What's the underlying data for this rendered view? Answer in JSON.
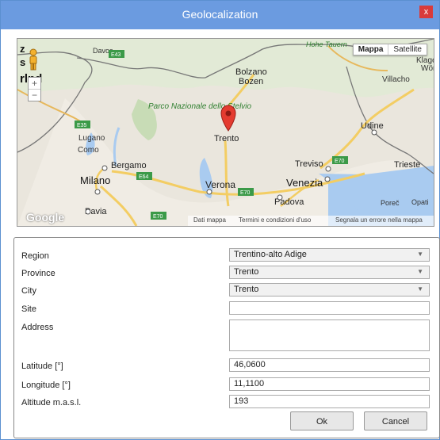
{
  "window": {
    "title": "Geolocalization",
    "close_symbol": "x"
  },
  "map": {
    "type_buttons": [
      "Mappa",
      "Satellite"
    ],
    "zoom": [
      "+",
      "−"
    ],
    "places": [
      {
        "name": "Davos"
      },
      {
        "name": "Bolzano"
      },
      {
        "name": "Bozen"
      },
      {
        "name": "Parco Nazionale dello Stelvio"
      },
      {
        "name": "Trento"
      },
      {
        "name": "Lugano"
      },
      {
        "name": "Como"
      },
      {
        "name": "Bergamo"
      },
      {
        "name": "Milano"
      },
      {
        "name": "Pavia"
      },
      {
        "name": "Verona"
      },
      {
        "name": "Padova"
      },
      {
        "name": "Venezia"
      },
      {
        "name": "Treviso"
      },
      {
        "name": "Udine"
      },
      {
        "name": "Trieste"
      },
      {
        "name": "Villacho"
      },
      {
        "name": "Hohe Tauern"
      },
      {
        "name": "Poreč"
      },
      {
        "name": "Opati"
      },
      {
        "name": "Klage"
      },
      {
        "name": "Wör"
      }
    ],
    "roads": [
      "E43",
      "E35",
      "E64",
      "E70",
      "E70",
      "E70"
    ],
    "partial_text": [
      "rlnd",
      "z",
      "s"
    ],
    "logo": "Google",
    "footer": [
      "Dati mappa",
      "Termini e condizioni d'uso",
      "Segnala un errore nella mappa"
    ]
  },
  "form": {
    "region_label": "Region",
    "region_value": "Trentino-alto Adige",
    "province_label": "Province",
    "province_value": "Trento",
    "city_label": "City",
    "city_value": "Trento",
    "site_label": "Site",
    "site_value": "",
    "address_label": "Address",
    "address_value": "",
    "latitude_label": "Latitude [°]",
    "latitude_value": "46,0600",
    "longitude_label": "Longitude [°]",
    "longitude_value": "11,1100",
    "altitude_label": "Altitude m.a.s.l.",
    "altitude_value": "193",
    "ok_label": "Ok",
    "cancel_label": "Cancel"
  }
}
